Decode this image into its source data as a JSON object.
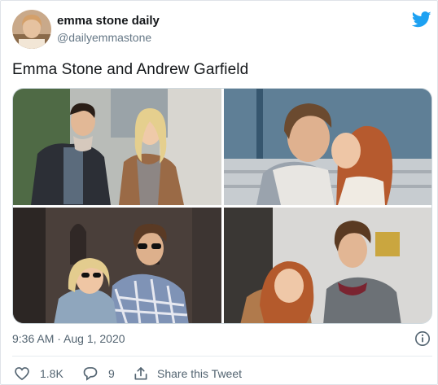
{
  "author": {
    "display_name": "emma stone daily",
    "handle": "@dailyemmastone",
    "avatar_icon": "avatar-photo"
  },
  "brand": {
    "icon": "twitter-bird-icon",
    "color": "#1da1f2"
  },
  "tweet": {
    "text": "Emma Stone and Andrew Garfield",
    "timestamp": "9:36 AM · Aug 1, 2020"
  },
  "media": {
    "photo_count": 4
  },
  "actions": {
    "like_count": "1.8K",
    "reply_count": "9",
    "share_label": "Share this Tweet"
  },
  "colors": {
    "text_primary": "#14171a",
    "text_secondary": "#536471",
    "like_accent": "#e0245e"
  }
}
